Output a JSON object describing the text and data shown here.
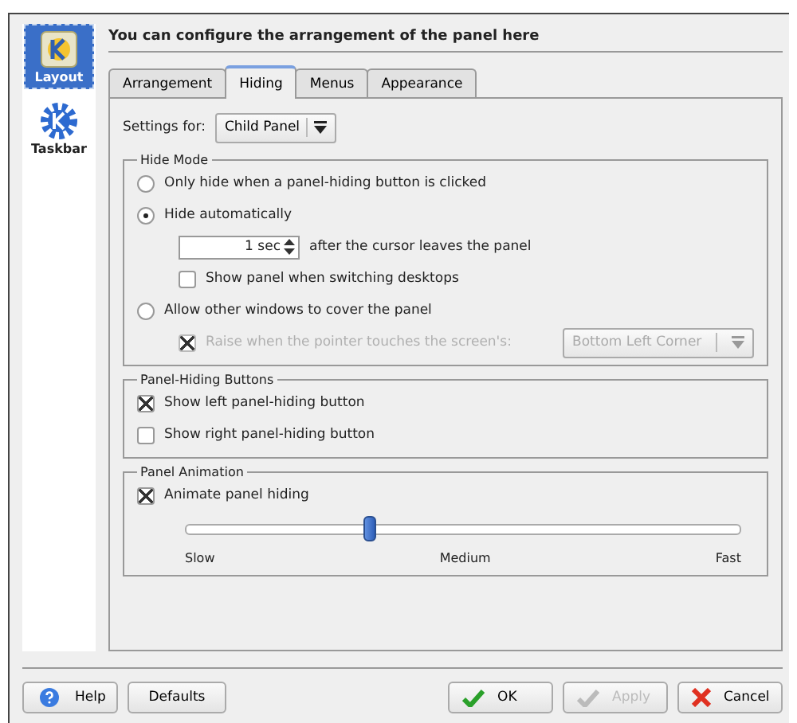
{
  "header": "You can configure the arrangement of the panel here",
  "sidebar": {
    "items": [
      {
        "label": "Layout",
        "kind": "layout",
        "selected": true
      },
      {
        "label": "Taskbar",
        "kind": "taskbar",
        "selected": false
      }
    ]
  },
  "tabs": [
    {
      "label": "Arrangement",
      "selected": false
    },
    {
      "label": "Hiding",
      "selected": true
    },
    {
      "label": "Menus",
      "selected": false
    },
    {
      "label": "Appearance",
      "selected": false
    }
  ],
  "settings_for": {
    "label": "Settings for:",
    "value": "Child Panel"
  },
  "hide_mode": {
    "title": "Hide Mode",
    "options": [
      {
        "label": "Only hide when a panel-hiding button is clicked",
        "selected": false
      },
      {
        "label": "Hide automatically",
        "selected": true
      },
      {
        "label": "Allow other windows to cover the panel",
        "selected": false
      }
    ],
    "delay": {
      "value": "1 sec",
      "suffix": "after the cursor leaves the panel"
    },
    "show_when_switching": {
      "label": "Show panel when switching desktops",
      "checked": false
    },
    "raise": {
      "label": "Raise when the pointer touches the screen's:",
      "checked": true,
      "disabled": true,
      "value": "Bottom Left Corner"
    }
  },
  "hiding_buttons": {
    "title": "Panel-Hiding Buttons",
    "items": [
      {
        "label": "Show left panel-hiding button",
        "checked": true
      },
      {
        "label": "Show right panel-hiding button",
        "checked": false
      }
    ]
  },
  "animation": {
    "title": "Panel Animation",
    "checkbox": {
      "label": "Animate panel hiding",
      "checked": true
    },
    "level": 0.33,
    "ticks": [
      "Slow",
      "Medium",
      "Fast"
    ]
  },
  "buttons": [
    {
      "label": "Help",
      "kind": "help",
      "disabled": false
    },
    {
      "label": "Defaults",
      "kind": "plain",
      "disabled": false
    },
    {
      "label": "OK",
      "kind": "ok",
      "disabled": false
    },
    {
      "label": "Apply",
      "kind": "apply",
      "disabled": true
    },
    {
      "label": "Cancel",
      "kind": "cancel",
      "disabled": false
    }
  ]
}
